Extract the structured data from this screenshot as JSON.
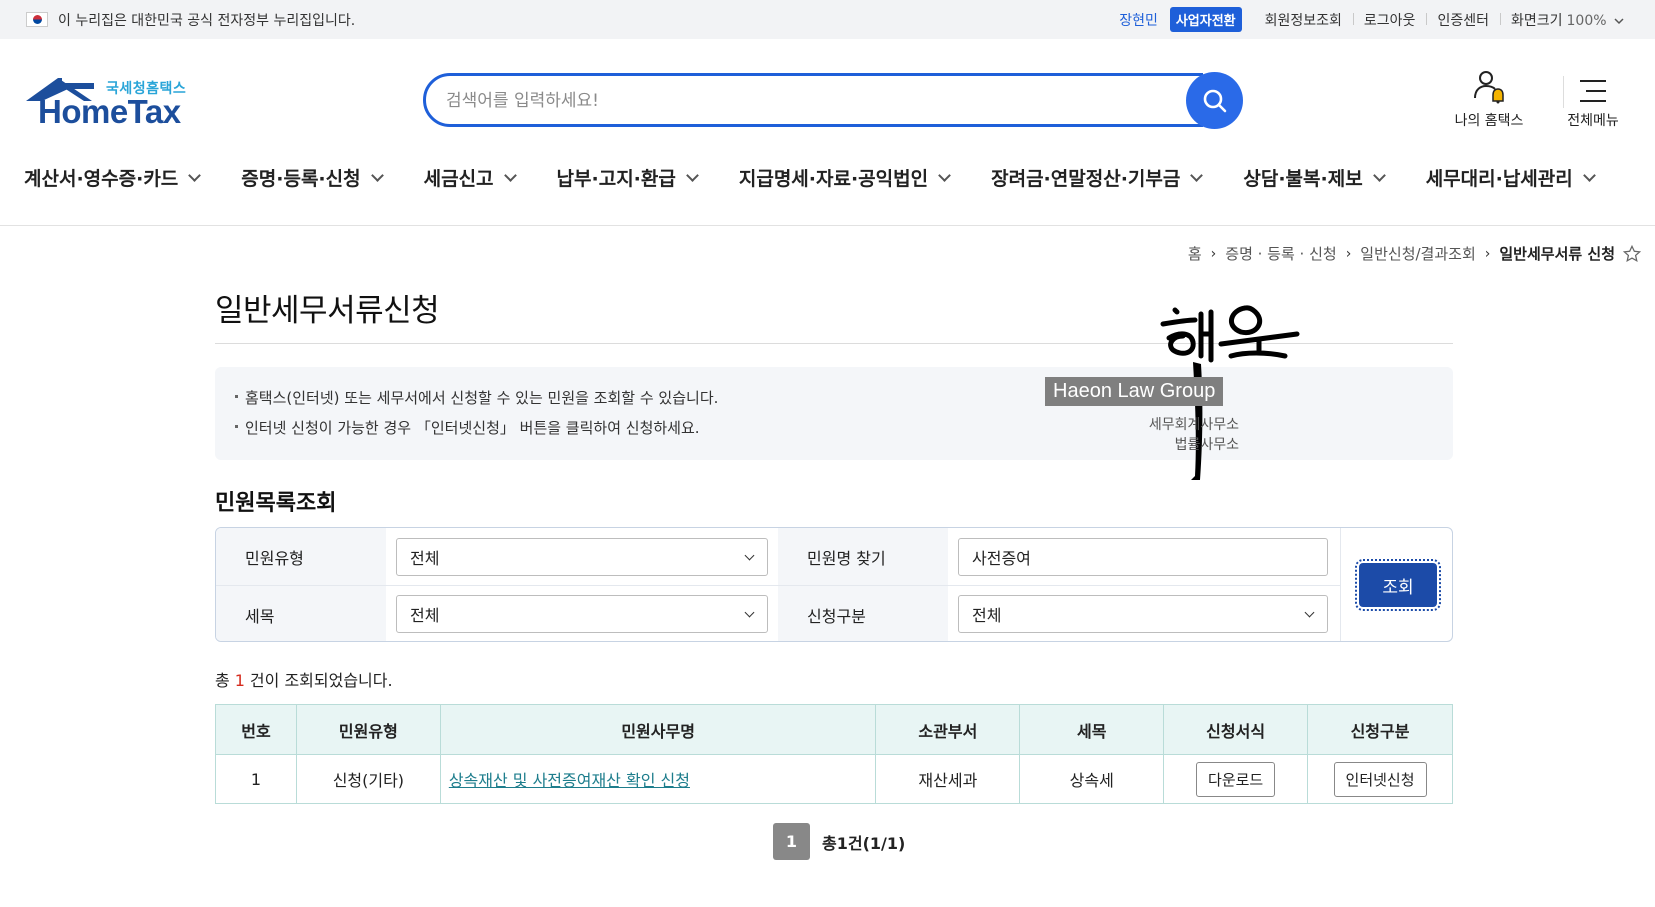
{
  "topbar": {
    "gov_notice": "이 누리집은 대한민국 공식 전자정부 누리집입니다.",
    "user_name": "장현민",
    "switch_business": "사업자전환",
    "links": [
      "회원정보조회",
      "로그아웃",
      "인증센터"
    ],
    "zoom_label": "화면크기",
    "zoom_value": "100%"
  },
  "logo": {
    "sub": "국세청홈택스",
    "main": "HomeTax"
  },
  "search": {
    "placeholder": "검색어를 입력하세요!"
  },
  "header_icons": {
    "my": "나의 홈택스",
    "menu": "전체메뉴"
  },
  "gnb": [
    "계산서·영수증·카드",
    "증명·등록·신청",
    "세금신고",
    "납부·고지·환급",
    "지급명세·자료·공익법인",
    "장려금·연말정산·기부금",
    "상담·불복·제보",
    "세무대리·납세관리"
  ],
  "breadcrumb": {
    "items": [
      "홈",
      "증명 · 등록 · 신청",
      "일반신청/결과조회"
    ],
    "current": "일반세무서류 신청"
  },
  "page_title": "일반세무서류신청",
  "notice": [
    "홈택스(인터넷) 또는 세무서에서 신청할 수 있는 민원을 조회할 수 있습니다.",
    "인터넷 신청이 가능한 경우 「인터넷신청」 버튼을 클릭하여 신청하세요."
  ],
  "watermark": {
    "script": "해온",
    "name": "Haeon Law Group",
    "sub1": "세무회계사무소",
    "sub2": "법률사무소"
  },
  "section_title": "민원목록조회",
  "filter": {
    "type_label": "민원유형",
    "type_value": "전체",
    "name_label": "민원명 찾기",
    "name_value": "사전증여",
    "tax_label": "세목",
    "tax_value": "전체",
    "apply_label": "신청구분",
    "apply_value": "전체",
    "search_button": "조회"
  },
  "result": {
    "prefix": "총",
    "count": "1",
    "suffix": "건이 조회되었습니다."
  },
  "table": {
    "headers": [
      "번호",
      "민원유형",
      "민원사무명",
      "소관부서",
      "세목",
      "신청서식",
      "신청구분"
    ],
    "rows": [
      {
        "no": "1",
        "type": "신청(기타)",
        "name": "상속재산 및 사전증여재산 확인 신청",
        "dept": "재산세과",
        "tax": "상속세",
        "form": "다운로드",
        "apply": "인터넷신청"
      }
    ]
  },
  "pager": {
    "current": "1",
    "total": "총1건(1/1)"
  }
}
